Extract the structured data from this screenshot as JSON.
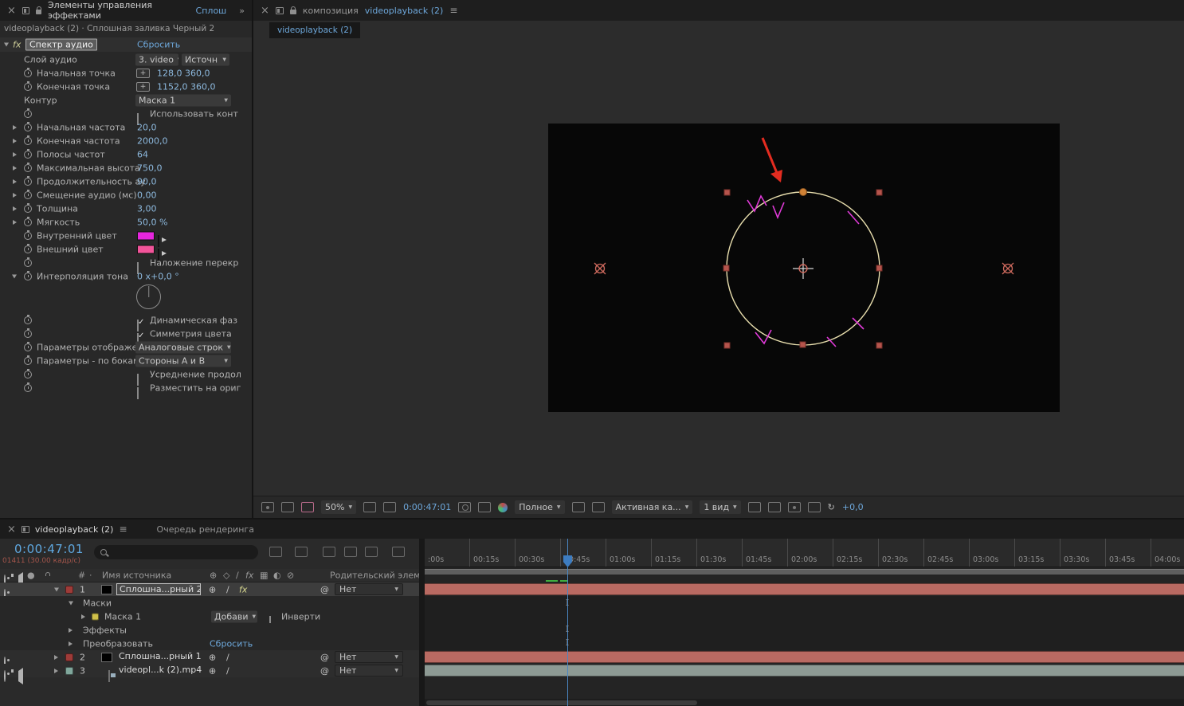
{
  "icons": {
    "close": "×",
    "menu": "≡",
    "more": "»",
    "hash": "#",
    "pickwhip": "@",
    "fx": "fx",
    "slash": "/",
    "anchor": "⊕",
    "shy": "◇",
    "blend": "▦",
    "transfer": "◐",
    "blur": "⊘",
    "dropdown": "▼",
    "refresh": "↻",
    "ibeam": "I",
    "solo": "●",
    "dot": "·"
  },
  "colors": {
    "inner": "#e626de",
    "outer": "#f2549a",
    "label_red": "#9e3b38",
    "label_yellow": "#cfc04a",
    "label_teal": "#80a79c",
    "bar_salmon": "#b96a62",
    "bar_teal": "#8d9a94"
  },
  "effect_panel": {
    "title": "Элементы управления эффектами",
    "title_link": "Сплош",
    "subtitle": "videoplayback (2) · Сплошная заливка Черный 2",
    "effect_name": "Спектр аудио",
    "reset": "Сбросить",
    "audio_layer": {
      "label": "Слой аудио",
      "value": "3. video",
      "source": "Источн"
    },
    "start_point": {
      "label": "Начальная точка",
      "value": "128,0 360,0",
      "btn": "+"
    },
    "end_point": {
      "label": "Конечная точка",
      "value": "1152,0 360,0",
      "btn": "+"
    },
    "path": {
      "label": "Контур",
      "value": "Маска 1"
    },
    "use_path": {
      "label": "Использовать конт"
    },
    "start_freq": {
      "label": "Начальная частота",
      "value": "20,0"
    },
    "end_freq": {
      "label": "Конечная частота",
      "value": "2000,0"
    },
    "bands": {
      "label": "Полосы частот",
      "value": "64"
    },
    "max_height": {
      "label": "Максимальная высота",
      "value": "750,0"
    },
    "audio_duration": {
      "label": "Продолжительность ау",
      "value": "90,0"
    },
    "audio_offset": {
      "label": "Смещение аудио (мс)",
      "value": "0,00"
    },
    "thickness": {
      "label": "Толщина",
      "value": "3,00"
    },
    "softness": {
      "label": "Мягкость",
      "value": "50,0 %"
    },
    "inner_color": {
      "label": "Внутренний цвет"
    },
    "outer_color": {
      "label": "Внешний цвет"
    },
    "blend_overlap": {
      "label": "Наложение перекр"
    },
    "hue_interp": {
      "label": "Интерполяция тона",
      "value": "0 x+0,0 °"
    },
    "dynamic_phase": {
      "label": "Динамическая фаз"
    },
    "color_symmetry": {
      "label": "Симметрия цвета"
    },
    "display_options": {
      "label": "Параметры отображен",
      "value": "Аналоговые строк"
    },
    "side_options": {
      "label": "Параметры - по бокам",
      "value": "Стороны А и В"
    },
    "duration_avg": {
      "label": "Усреднение продол"
    },
    "composite": {
      "label": "Разместить на ориг"
    }
  },
  "comp_panel": {
    "tab_prefix": "композиция",
    "tab_link": "videoplayback (2)",
    "comp_tab": "videoplayback (2)",
    "toolbar": {
      "zoom": "50%",
      "timecode": "0:00:47:01",
      "resolution": "Полное",
      "camera": "Активная ка...",
      "view": "1 вид",
      "exposure": "+0,0"
    }
  },
  "timeline": {
    "tab_active": "videoplayback (2)",
    "tab_render": "Очередь рендеринга",
    "timecode": "0:00:47:01",
    "frame_info": "01411 (30.00 кадр/с)",
    "search_placeholder": "",
    "col_source": "Имя источника",
    "col_parent": "Родительский элемент ...",
    "none": "Нет",
    "layers": [
      {
        "num": "1",
        "name": "Сплошна...рный 2"
      },
      {
        "num": "2",
        "name": "Сплошна...рный 1"
      },
      {
        "num": "3",
        "name": "videopl...k (2).mp4"
      }
    ],
    "group_masks": "Маски",
    "mask1": "Маска 1",
    "mask_mode": "Добави",
    "inverted": "Инверти",
    "group_effects": "Эффекты",
    "group_transform": "Преобразовать",
    "reset": "Сбросить",
    "ruler": [
      ":00s",
      "00:15s",
      "00:30s",
      "00:45s",
      "01:00s",
      "01:15s",
      "01:30s",
      "01:45s",
      "02:00s",
      "02:15s",
      "02:30s",
      "02:45s",
      "03:00s",
      "03:15s",
      "03:30s",
      "03:45s",
      "04:00s"
    ]
  }
}
